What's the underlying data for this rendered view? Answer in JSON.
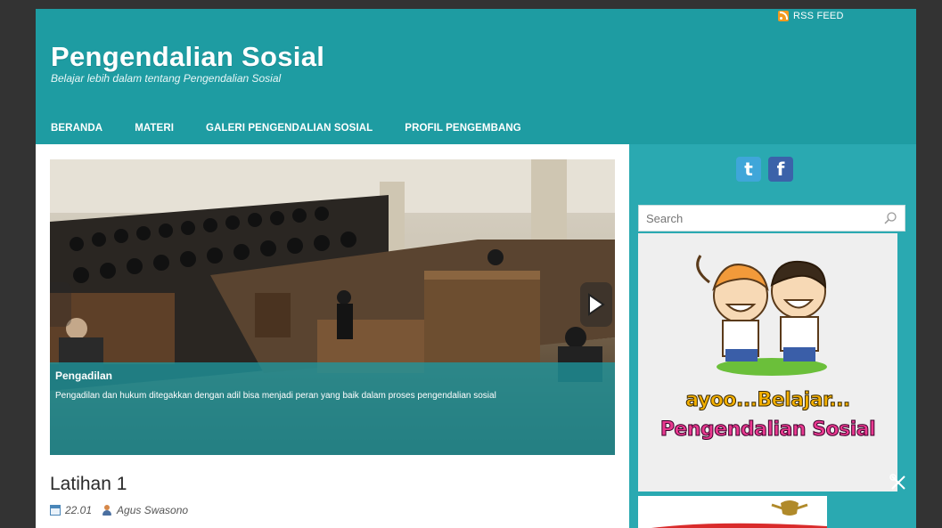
{
  "header": {
    "rss_label": "RSS FEED",
    "site_title": "Pengendalian Sosial",
    "tagline": "Belajar lebih dalam tentang Pengendalian Sosial"
  },
  "nav": {
    "items": [
      {
        "label": "BERANDA"
      },
      {
        "label": "MATERI"
      },
      {
        "label": "GALERI PENGENDALIAN SOSIAL"
      },
      {
        "label": "PROFIL PENGEMBANG"
      }
    ]
  },
  "slider": {
    "caption_title": "Pengadilan",
    "caption_text": "Pengadilan dan hukum ditegakkan dengan adil bisa menjadi peran yang baik dalam proses pengendalian sosial"
  },
  "post": {
    "title": "Latihan 1",
    "time": "22.01",
    "author": "Agus Swasono"
  },
  "sidebar": {
    "social": [
      {
        "icon": "twitter-icon",
        "glyph": "t"
      },
      {
        "icon": "facebook-icon",
        "glyph": "f"
      }
    ],
    "search_placeholder": "Search",
    "banner_line1": "ayoo...Belajar...",
    "banner_line2": "Pengendalian Sosial"
  },
  "colors": {
    "page_bg": "#1e9ca2",
    "sidebar_bg": "#2aa9b1",
    "outer_bg": "#333333",
    "caption_bg": "#1e969e"
  }
}
